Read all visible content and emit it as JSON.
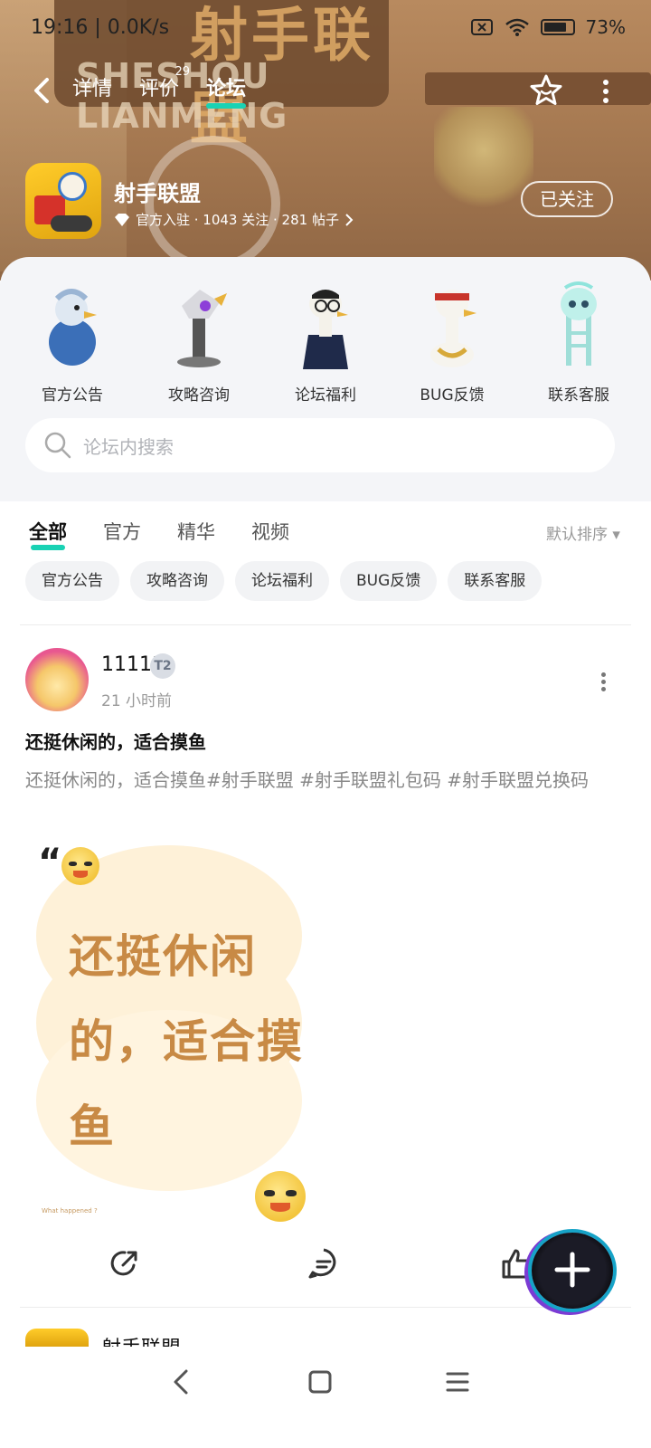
{
  "status_bar": {
    "time": "19:16 | 0.0K/s",
    "battery": "73%"
  },
  "nav": {
    "tabs": [
      {
        "label": "详情"
      },
      {
        "label": "评价",
        "count": "29"
      },
      {
        "label": "论坛",
        "active": true
      }
    ]
  },
  "banner_art": {
    "title": "射手联盟",
    "subtitle": "SHESHOU LIANMENG"
  },
  "game": {
    "title": "射手联盟",
    "meta": "官方入驻 · 1043 关注 · 281 帖子",
    "follow_label": "已关注"
  },
  "categories": [
    {
      "label": "官方公告",
      "icon": "pigeon-avatar-icon"
    },
    {
      "label": "攻略咨询",
      "icon": "robot-pigeon-avatar-icon"
    },
    {
      "label": "论坛福利",
      "icon": "goose-glasses-avatar-icon"
    },
    {
      "label": "BUG反馈",
      "icon": "goose-headband-avatar-icon"
    },
    {
      "label": "联系客服",
      "icon": "ghost-goose-avatar-icon"
    }
  ],
  "search": {
    "placeholder": "论坛内搜索"
  },
  "feed_filters": [
    {
      "label": "全部",
      "active": true
    },
    {
      "label": "官方"
    },
    {
      "label": "精华"
    },
    {
      "label": "视频"
    }
  ],
  "sort_label": "默认排序 ▾",
  "chips": [
    "官方公告",
    "攻略咨询",
    "论坛福利",
    "BUG反馈",
    "联系客服"
  ],
  "post": {
    "author": "11111",
    "badge": "T2",
    "time": "21 小时前",
    "title": "还挺休闲的，适合摸鱼",
    "body": "还挺休闲的，适合摸鱼#射手联盟 #射手联盟礼包码 #射手联盟兑换码",
    "image_text": "还挺休闲的，适合摸鱼",
    "image_caption": "What happened ?"
  },
  "next_post": {
    "author": "射手联盟"
  },
  "colors": {
    "accent": "#19d2b4",
    "image_text": "#c88a45"
  }
}
